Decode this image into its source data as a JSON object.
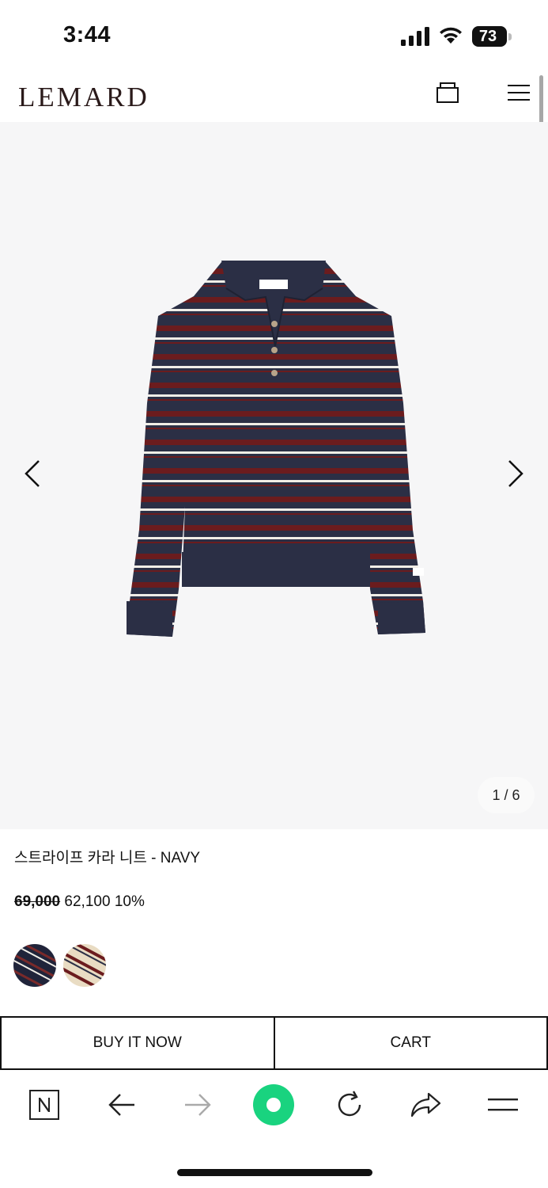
{
  "status_bar": {
    "time": "3:44",
    "battery": "73"
  },
  "header": {
    "logo": "LEMARD",
    "icons": [
      "shopping-bag-icon",
      "hamburger-menu-icon"
    ]
  },
  "gallery": {
    "counter": "1 / 6",
    "product_image": "striped-collar-knit-navy",
    "icons": [
      "chevron-left-icon",
      "chevron-right-icon"
    ]
  },
  "product": {
    "name": "스트라이프 카라 니트 - NAVY",
    "price_original": "69,000",
    "price_sale": "62,100",
    "discount": "10%",
    "color_swatches": [
      "navy-stripe",
      "cream-stripe"
    ]
  },
  "actions": {
    "buy_now": "BUY IT NOW",
    "cart": "CART"
  },
  "browser_toolbar": {
    "icons": [
      "naver-n-icon",
      "back-arrow-icon",
      "forward-arrow-icon",
      "green-circle-icon",
      "refresh-icon",
      "share-icon",
      "menu-lines-icon"
    ]
  },
  "colors": {
    "navy": "#2b2f45",
    "burgundy": "#6b1c1e",
    "accent_green": "#19d37f",
    "gallery_bg": "#f6f6f7"
  }
}
